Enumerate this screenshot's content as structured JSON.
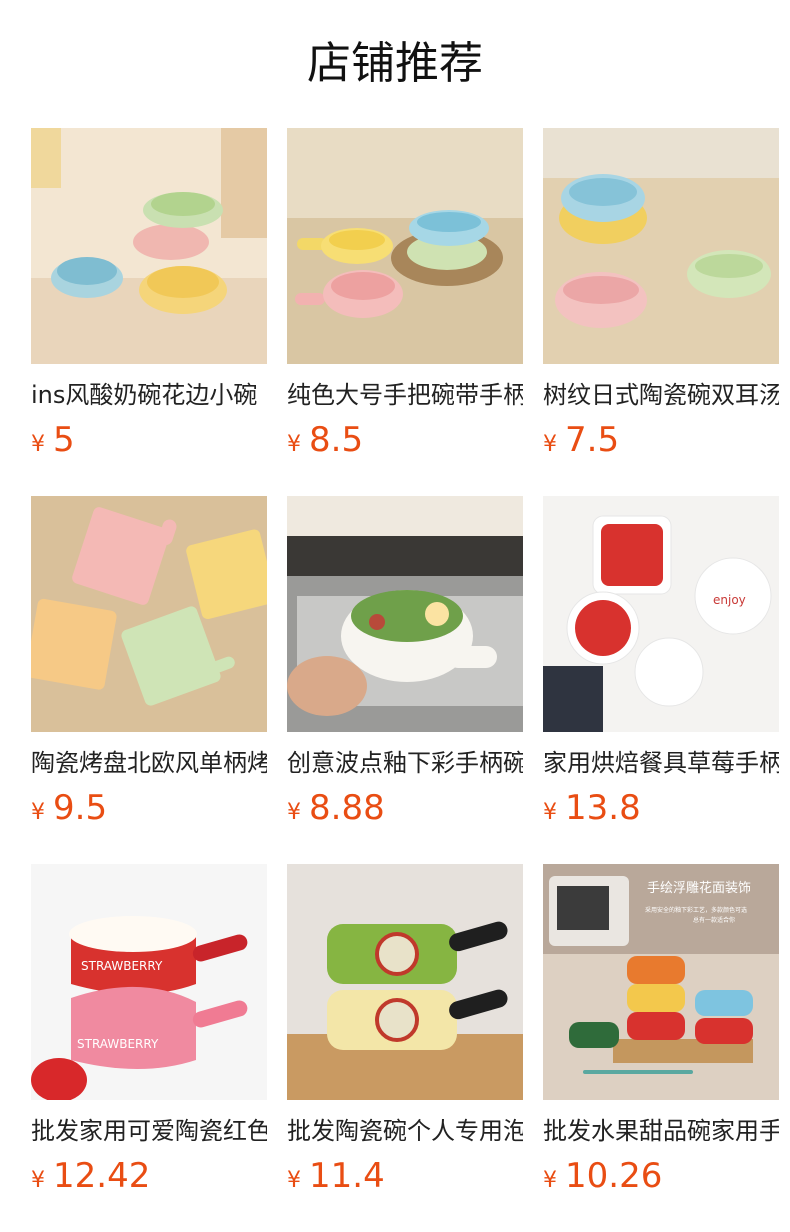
{
  "section_title": "店铺推荐",
  "currency": "¥",
  "products": [
    {
      "name": "ins风酸奶碗花边小碗",
      "price": "5"
    },
    {
      "name": "纯色大号手把碗带手柄",
      "price": "8.5"
    },
    {
      "name": "树纹日式陶瓷碗双耳汤",
      "price": "7.5"
    },
    {
      "name": "陶瓷烤盘北欧风单柄烤",
      "price": "9.5"
    },
    {
      "name": "创意波点釉下彩手柄碗",
      "price": "8.88"
    },
    {
      "name": "家用烘焙餐具草莓手柄",
      "price": "13.8"
    },
    {
      "name": "批发家用可爱陶瓷红色",
      "price": "12.42"
    },
    {
      "name": "批发陶瓷碗个人专用泡",
      "price": "11.4"
    },
    {
      "name": "批发水果甜品碗家用手",
      "price": "10.26"
    }
  ],
  "image_text": {
    "strawberry": "STRAWBERRY",
    "enjoy": "enjoy",
    "banner_title": "手绘浮雕花面装饰",
    "banner_sub1": "采用安全的釉下彩工艺，多款颜色可选",
    "banner_sub2": "总有一款适合你"
  }
}
